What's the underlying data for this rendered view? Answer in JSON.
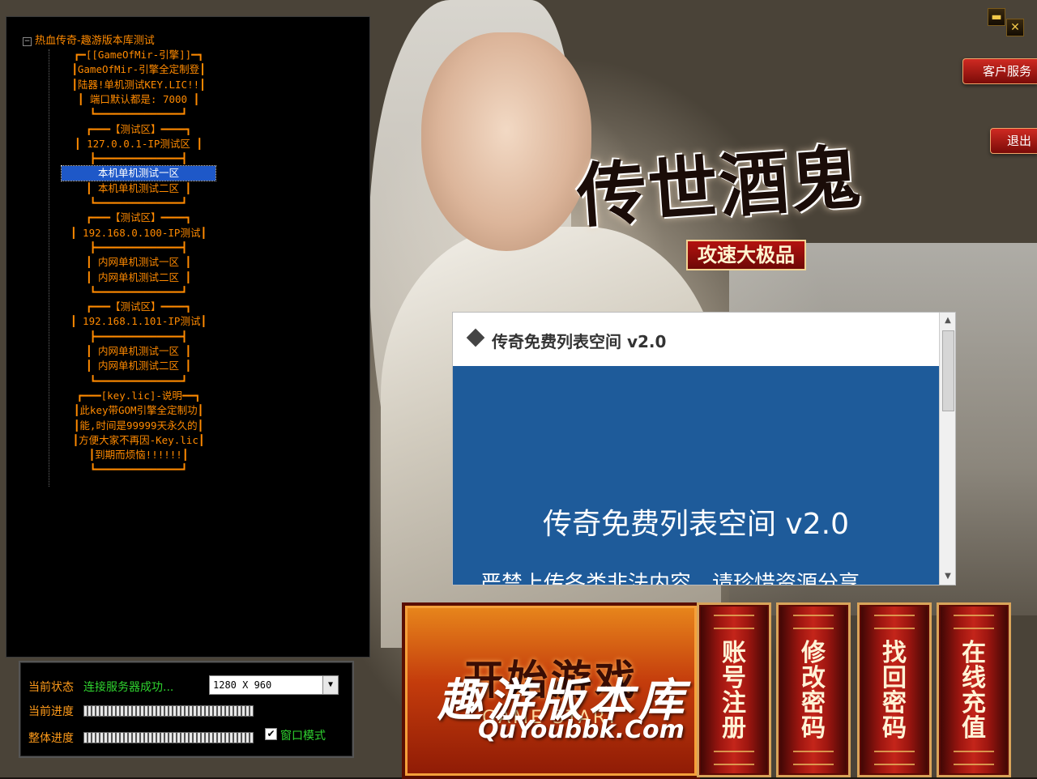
{
  "window": {
    "minimize": "▬",
    "close": "✕",
    "service_label": "客户服务",
    "exit_label": "退出"
  },
  "logo": {
    "title": "传世酒鬼",
    "subtitle": "攻速大极品"
  },
  "tree": {
    "root_label": "热血传奇-趣游版本库测试",
    "items": [
      "┏━[[GameOfMir-引擎]]━┓",
      "┃GameOfMir-引擎全定制登┃",
      "┃陆器!单机测试KEY.LIC!!┃",
      "┃  端口默认都是: 7000  ┃",
      "┗━━━━━━━━━━━━━━┛",
      "┏━━━【测试区】━━━━┓",
      "┃ 127.0.0.1-IP测试区 ┃",
      "┣━━━━━━━━━━━━━━┫",
      "本机单机测试一区",
      "┃   本机单机测试二区   ┃",
      "┗━━━━━━━━━━━━━━┛",
      "┏━━━【测试区】━━━━┓",
      "┃ 192.168.0.100-IP测试┃",
      "┣━━━━━━━━━━━━━━┫",
      "┃   内网单机测试一区   ┃",
      "┃   内网单机测试二区   ┃",
      "┗━━━━━━━━━━━━━━┛",
      "┏━━━【测试区】━━━━┓",
      "┃ 192.168.1.101-IP测试┃",
      "┣━━━━━━━━━━━━━━┫",
      "┃   内网单机测试一区   ┃",
      "┃   内网单机测试二区   ┃",
      "┗━━━━━━━━━━━━━━┛",
      "┏━━━[key.lic]-说明━━┓",
      "┃此key带GOM引擎全定制功┃",
      "┃能,时间是99999天永久的┃",
      "┃方便大家不再因-Key.lic┃",
      "┃到期而烦恼!!!!!!┃",
      "┗━━━━━━━━━━━━━━┛"
    ],
    "selected_index": 8
  },
  "status": {
    "state_label": "当前状态",
    "state_value": "连接服务器成功...",
    "progress_label": "当前进度",
    "total_label": "整体进度",
    "resolution": "1280 X 960",
    "window_mode_label": "窗口模式",
    "window_mode_checked": true,
    "progress_fraction": 1.0,
    "total_fraction": 1.0
  },
  "web": {
    "title": "传奇免费列表空间 v2.0",
    "headline": "传奇免费列表空间 v2.0",
    "notice": "严禁上传各类非法内容，请珍惜资源分享"
  },
  "buttons": {
    "start": "开始游戏",
    "start_sub": "GAME START",
    "register": "账号注册",
    "change_password": "修改密码",
    "recover_password": "找回密码",
    "recharge": "在线充值"
  },
  "watermark": {
    "cn": "趣游版本库",
    "en": "QuYoubbk.Com"
  }
}
